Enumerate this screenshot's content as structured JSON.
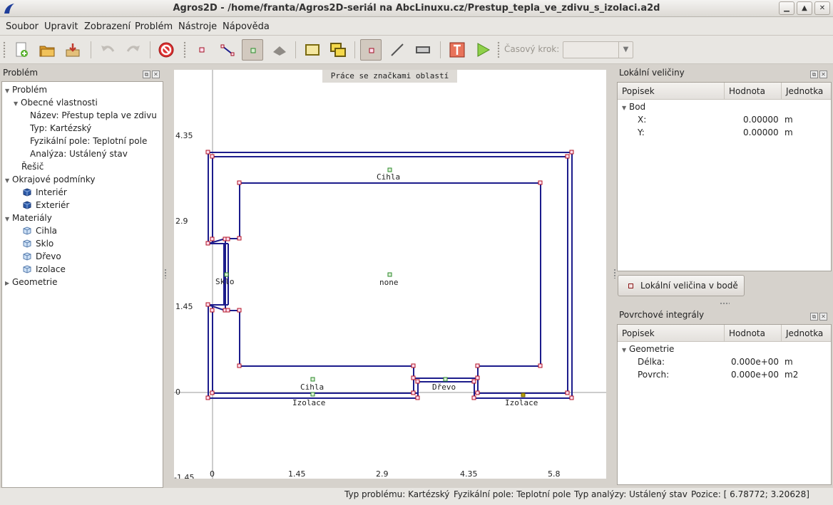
{
  "window": {
    "title": "Agros2D - /home/franta/Agros2D-seriál na AbcLinuxu.cz/Prestup_tepla_ve_zdivu_s_izolaci.a2d"
  },
  "menu": [
    "Soubor",
    "Upravit",
    "Zobrazení",
    "Problém",
    "Nástroje",
    "Nápověda"
  ],
  "toolbar": {
    "buttons": [
      {
        "name": "new-icon"
      },
      {
        "name": "open-folder-icon"
      },
      {
        "name": "save-icon"
      },
      {
        "name": "undo-icon"
      },
      {
        "name": "redo-icon"
      },
      {
        "name": "stop-icon"
      },
      {
        "name": "node-mode-icon"
      },
      {
        "name": "edge-mode-icon"
      },
      {
        "name": "label-mode-icon"
      },
      {
        "name": "postprocessor-mode-icon"
      },
      {
        "name": "rectangle-select-icon"
      },
      {
        "name": "multi-rectangle-icon"
      },
      {
        "name": "point-tool-icon"
      },
      {
        "name": "line-tool-icon"
      },
      {
        "name": "surface-tool-icon"
      },
      {
        "name": "text-tool-icon"
      },
      {
        "name": "solve-icon"
      }
    ],
    "timestep_label": "Časový krok:",
    "timestep_value": ""
  },
  "problem_panel": {
    "title": "Problém",
    "tree": [
      {
        "text": "Problém",
        "level": 0,
        "toggle": "open"
      },
      {
        "text": "Obecné vlastnosti",
        "level": 1,
        "toggle": "open"
      },
      {
        "text": "Název: Přestup tepla ve zdivu",
        "level": 2
      },
      {
        "text": "Typ: Kartézský",
        "level": 2
      },
      {
        "text": "Fyzikální pole: Teplotní pole",
        "level": 2
      },
      {
        "text": "Analýza: Ustálený stav",
        "level": 2
      },
      {
        "text": "Řešič",
        "level": 1
      },
      {
        "text": "Okrajové podmínky",
        "level": 0,
        "toggle": "open"
      },
      {
        "text": "Interiér",
        "level": 2,
        "icon": "boundary-cube-icon"
      },
      {
        "text": "Exteriér",
        "level": 2,
        "icon": "boundary-cube-icon"
      },
      {
        "text": "Materiály",
        "level": 0,
        "toggle": "open"
      },
      {
        "text": "Cihla",
        "level": 2,
        "icon": "material-cube-icon"
      },
      {
        "text": "Sklo",
        "level": 2,
        "icon": "material-cube-icon"
      },
      {
        "text": "Dřevo",
        "level": 2,
        "icon": "material-cube-icon"
      },
      {
        "text": "Izolace",
        "level": 2,
        "icon": "material-cube-icon"
      },
      {
        "text": "Geometrie",
        "level": 0,
        "toggle": "closed"
      }
    ]
  },
  "canvas": {
    "banner": "Práce se značkami oblastí",
    "y_ticks": [
      "4.35",
      "2.9",
      "1.45",
      "0",
      "-1.45"
    ],
    "x_ticks": [
      "0",
      "1.45",
      "2.9",
      "4.35",
      "5.8"
    ],
    "labels": [
      "Cihla",
      "Sklo",
      "none",
      "Cihla",
      "Izolace",
      "Dřevo",
      "Izolace"
    ],
    "colors": {
      "edge": "#1c1c8c",
      "node": "#b01020",
      "label_marker": "#2a8a2a",
      "axis": "#888888"
    }
  },
  "local_values": {
    "title": "Lokální veličiny",
    "columns": [
      "Popisek",
      "Hodnota",
      "Jednotka"
    ],
    "group": "Bod",
    "rows": [
      {
        "name": "X:",
        "value": "0.00000",
        "unit": "m"
      },
      {
        "name": "Y:",
        "value": "0.00000",
        "unit": "m"
      }
    ],
    "button": "Lokální veličina v bodě"
  },
  "surface_integrals": {
    "title": "Povrchové integrály",
    "columns": [
      "Popisek",
      "Hodnota",
      "Jednotka"
    ],
    "group": "Geometrie",
    "rows": [
      {
        "name": "Délka:",
        "value": "0.000e+00",
        "unit": "m"
      },
      {
        "name": "Povrch:",
        "value": "0.000e+00",
        "unit": "m2"
      }
    ]
  },
  "statusbar": {
    "problem_type": "Typ problému: Kartézský",
    "field": "Fyzikální pole: Teplotní pole",
    "analysis": "Typ analýzy: Ustálený stav",
    "position": "Pozice: [ 6.78772;  3.20628]"
  }
}
